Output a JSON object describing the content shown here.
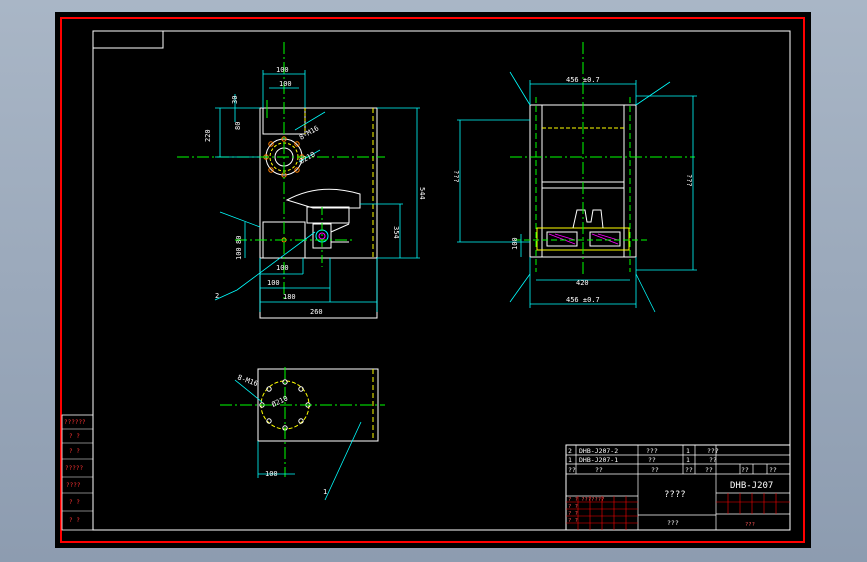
{
  "colors": {
    "frame": "#ff0000",
    "border": "#ffffff",
    "centerline": "#00ff00",
    "outline": "#ffffff",
    "hidden": "#ffff00",
    "dimension": "#00ffff",
    "hatch": "#ff00ff"
  },
  "front_view": {
    "dims": {
      "d100_top": "100",
      "d100_inner": "100",
      "d30": "30",
      "d220": "220",
      "d80": "80",
      "hole_pattern": "8-M16",
      "bolt_circle": "Ø210",
      "d544": "544",
      "d354": "354",
      "d80_low": "80",
      "d100_side": "100",
      "d100_bottom": "100",
      "d100_base": "100",
      "d180": "180",
      "d260": "260"
    },
    "balloon": "2"
  },
  "side_view": {
    "dims": {
      "top_width": "456 ±0.7",
      "height": "???",
      "inner_height": "???",
      "d100": "100",
      "d420": "420",
      "bottom_width": "456 ±0.7"
    }
  },
  "top_view": {
    "dims": {
      "hole_pattern": "8-M16",
      "bolt_circle": "Ø210",
      "d100": "100"
    },
    "balloon": "1"
  },
  "left_strip": {
    "rows": [
      "??????",
      "? ?",
      "? ?",
      "?????",
      "????",
      "? ?",
      "? ?"
    ]
  },
  "title_block": {
    "parts": [
      {
        "no": "2",
        "code": "DHB-J207-2",
        "name": "???",
        "qty": "1",
        "material": "???"
      },
      {
        "no": "1",
        "code": "DHB-J207-1",
        "name": "??",
        "qty": "1",
        "material": "??"
      }
    ],
    "header": [
      "??",
      "??",
      "??",
      "??",
      "??",
      "??",
      "??"
    ],
    "drawing_name": "????",
    "drawing_code": "DHB-J207",
    "company": "???",
    "sign_cells": [
      "? ? ???????",
      "? ?",
      "? ?",
      "? ?"
    ],
    "corner_label": "???"
  }
}
